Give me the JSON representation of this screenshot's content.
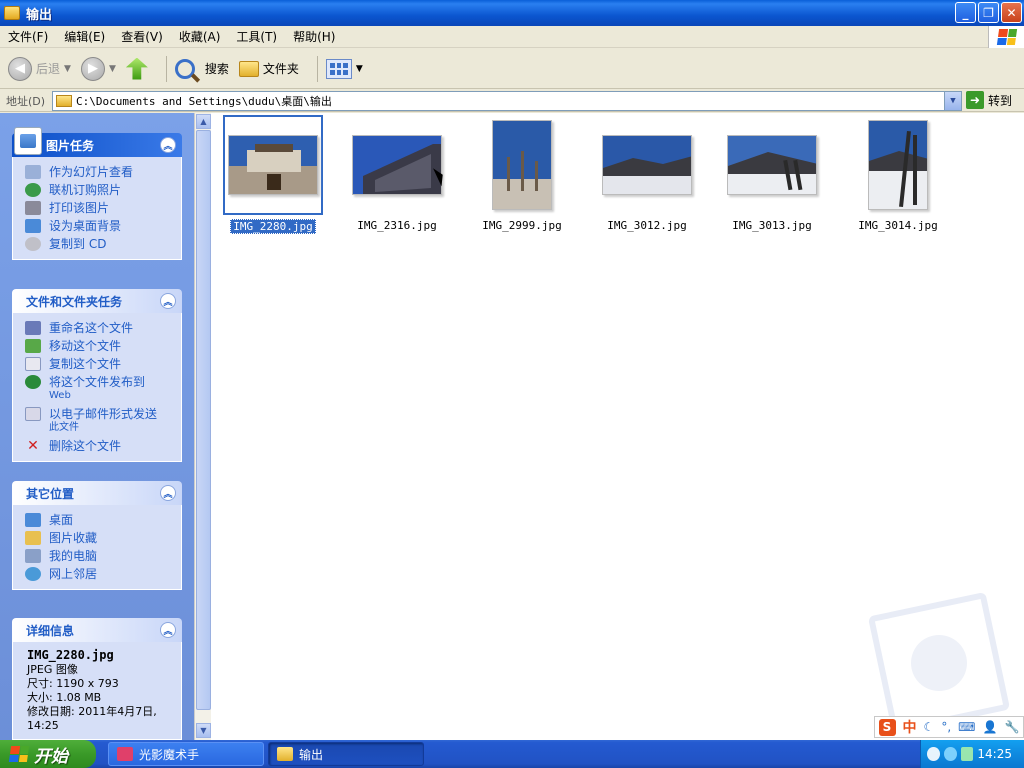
{
  "window": {
    "title": "输出"
  },
  "menu": [
    "文件(F)",
    "编辑(E)",
    "查看(V)",
    "收藏(A)",
    "工具(T)",
    "帮助(H)"
  ],
  "toolbar": {
    "back_label": "后退",
    "search_label": "搜索",
    "folders_label": "文件夹"
  },
  "address": {
    "label": "地址(D)",
    "path": "C:\\Documents and Settings\\dudu\\桌面\\输出",
    "go_label": "转到"
  },
  "panels": {
    "picture_tasks": {
      "title": "图片任务",
      "items": [
        "作为幻灯片查看",
        "联机订购照片",
        "打印该图片",
        "设为桌面背景",
        "复制到 CD"
      ]
    },
    "file_tasks": {
      "title": "文件和文件夹任务",
      "items": [
        {
          "label": "重命名这个文件",
          "sub": ""
        },
        {
          "label": "移动这个文件",
          "sub": ""
        },
        {
          "label": "复制这个文件",
          "sub": ""
        },
        {
          "label": "将这个文件发布到",
          "sub": "Web"
        },
        {
          "label": "以电子邮件形式发送",
          "sub": "此文件"
        },
        {
          "label": "删除这个文件",
          "sub": ""
        }
      ]
    },
    "other_places": {
      "title": "其它位置",
      "items": [
        "桌面",
        "图片收藏",
        "我的电脑",
        "网上邻居"
      ]
    },
    "details": {
      "title": "详细信息",
      "filename": "IMG_2280.jpg",
      "type": "JPEG 图像",
      "size_dims": "尺寸: 1190 x 793",
      "file_size": "大小: 1.08 MB",
      "modified": "修改日期: 2011年4月7日, 14:25"
    }
  },
  "files": [
    {
      "name": "IMG_2280.jpg",
      "selected": true
    },
    {
      "name": "IMG_2316.jpg",
      "selected": false
    },
    {
      "name": "IMG_2999.jpg",
      "selected": false
    },
    {
      "name": "IMG_3012.jpg",
      "selected": false
    },
    {
      "name": "IMG_3013.jpg",
      "selected": false
    },
    {
      "name": "IMG_3014.jpg",
      "selected": false
    }
  ],
  "ime": {
    "mode": "中"
  },
  "taskbar": {
    "start_label": "开始",
    "buttons": [
      "光影魔术手",
      "输出"
    ],
    "clock": "14:25"
  }
}
